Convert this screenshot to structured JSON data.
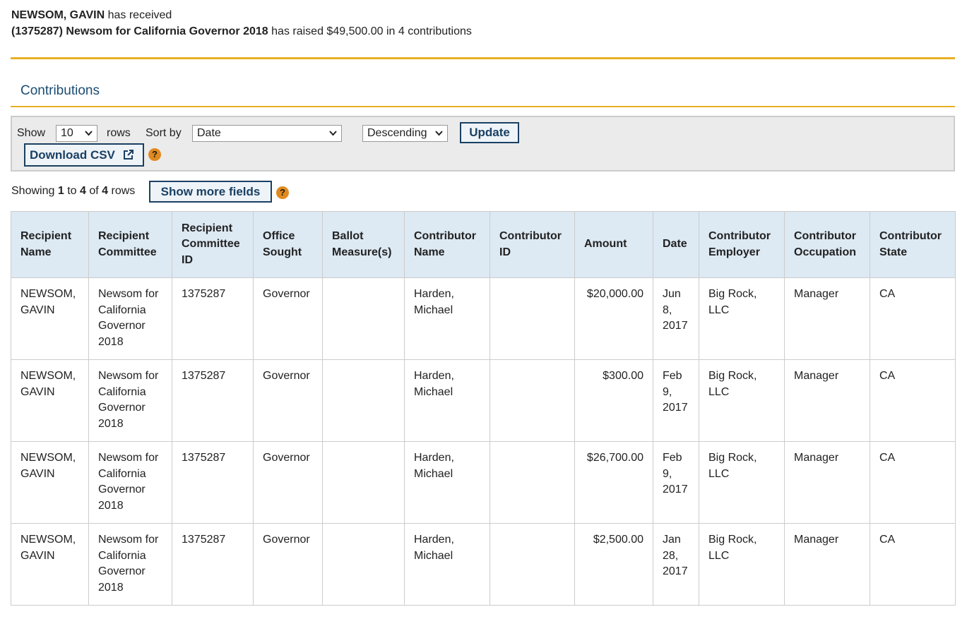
{
  "summary": {
    "recipient_name": "NEWSOM, GAVIN",
    "recipient_suffix": "has received",
    "committee": "(1375287) Newsom for California Governor 2018",
    "raised_text": "has raised $49,500.00 in 4 contributions"
  },
  "section_title": "Contributions",
  "controls": {
    "show_label": "Show",
    "rows_value": "10",
    "rows_label": "rows",
    "sort_label": "Sort by",
    "sort_value": "Date",
    "order_value": "Descending",
    "update_label": "Update",
    "download_label": "Download CSV",
    "help_glyph": "?"
  },
  "showing": {
    "prefix": "Showing",
    "from": "1",
    "to_word": "to",
    "to": "4",
    "of_word": "of",
    "total": "4",
    "suffix": "rows",
    "more_fields_label": "Show more fields"
  },
  "table": {
    "headers": [
      "Recipient Name",
      "Recipient Committee",
      "Recipient Committee ID",
      "Office Sought",
      "Ballot Measure(s)",
      "Contributor Name",
      "Contributor ID",
      "Amount",
      "Date",
      "Contributor Employer",
      "Contributor Occupation",
      "Contributor State"
    ],
    "rows": [
      [
        "NEWSOM, GAVIN",
        "Newsom for California Governor 2018",
        "1375287",
        "Governor",
        "",
        "Harden, Michael",
        "",
        "$20,000.00",
        "Jun 8, 2017",
        "Big Rock, LLC",
        "Manager",
        "CA"
      ],
      [
        "NEWSOM, GAVIN",
        "Newsom for California Governor 2018",
        "1375287",
        "Governor",
        "",
        "Harden, Michael",
        "",
        "$300.00",
        "Feb 9, 2017",
        "Big Rock, LLC",
        "Manager",
        "CA"
      ],
      [
        "NEWSOM, GAVIN",
        "Newsom for California Governor 2018",
        "1375287",
        "Governor",
        "",
        "Harden, Michael",
        "",
        "$26,700.00",
        "Feb 9, 2017",
        "Big Rock, LLC",
        "Manager",
        "CA"
      ],
      [
        "NEWSOM, GAVIN",
        "Newsom for California Governor 2018",
        "1375287",
        "Governor",
        "",
        "Harden, Michael",
        "",
        "$2,500.00",
        "Jan 28, 2017",
        "Big Rock, LLC",
        "Manager",
        "CA"
      ]
    ]
  },
  "colors": {
    "accent_gold": "#e8b023",
    "title_blue": "#1a4d72",
    "button_navy": "#1a4063",
    "header_bg": "#dde9f3",
    "help_orange": "#e08a1e"
  },
  "icons": {
    "dropdown": "chevron-down-icon",
    "external": "external-link-icon",
    "help": "help-icon"
  }
}
